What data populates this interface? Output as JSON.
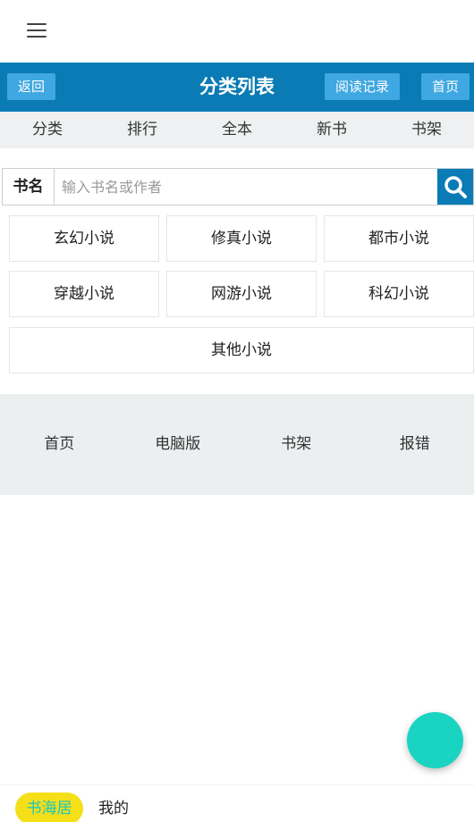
{
  "header": {
    "back_label": "返回",
    "title": "分类列表",
    "history_label": "阅读记录",
    "home_label": "首页"
  },
  "nav": [
    "分类",
    "排行",
    "全本",
    "新书",
    "书架"
  ],
  "search": {
    "label": "书名",
    "placeholder": "输入书名或作者",
    "icon": "search-icon"
  },
  "categories": [
    "玄幻小说",
    "修真小说",
    "都市小说",
    "穿越小说",
    "网游小说",
    "科幻小说",
    "其他小说"
  ],
  "footer": [
    "首页",
    "电脑版",
    "书架",
    "报错"
  ],
  "bottom": {
    "brand": "书海居",
    "mine": "我的"
  },
  "colors": {
    "header_bg": "#0a7bb4",
    "button_bg": "#3fa7e1",
    "fab": "#19d4c0",
    "brand_pill_bg": "#f4df19",
    "brand_pill_text": "#19c7c0"
  }
}
